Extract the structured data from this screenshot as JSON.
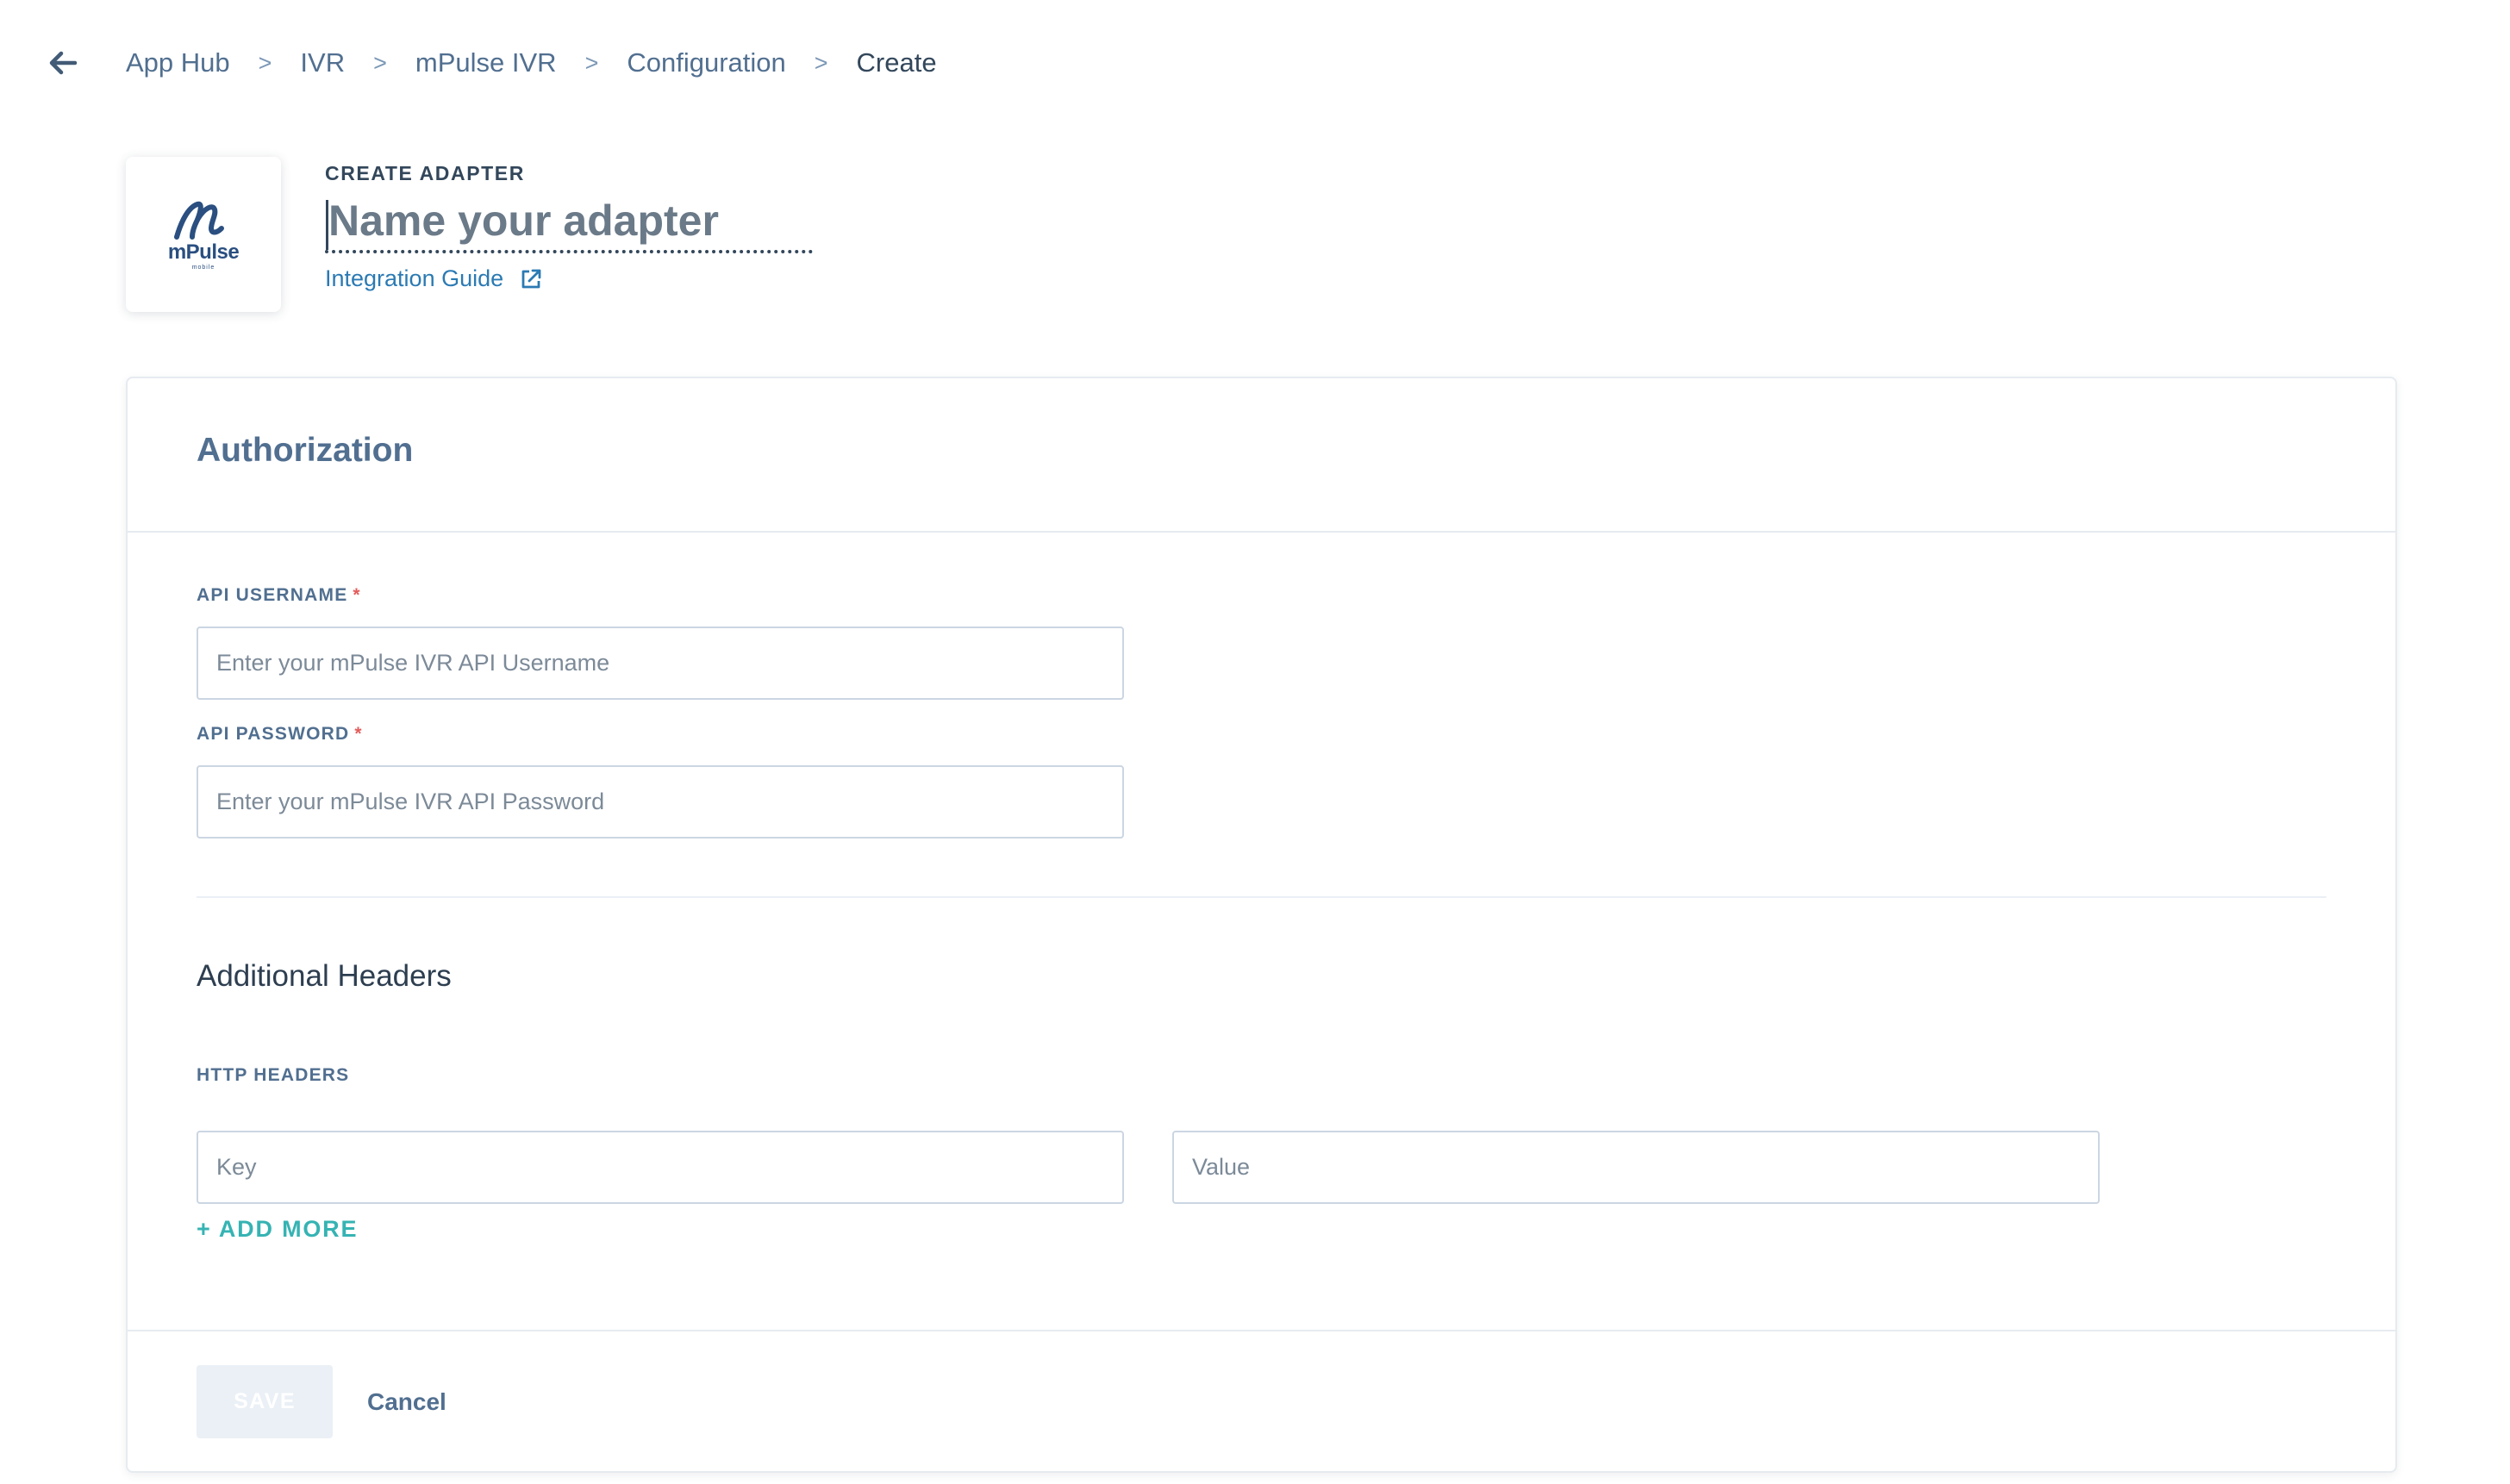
{
  "breadcrumb": {
    "items": [
      "App Hub",
      "IVR",
      "mPulse IVR",
      "Configuration",
      "Create"
    ],
    "separator": ">"
  },
  "header": {
    "logo": {
      "text": "mPulse",
      "sub": "mobile"
    },
    "label": "CREATE ADAPTER",
    "name_placeholder": "Name your adapter",
    "name_value": "",
    "guide_link": "Integration Guide"
  },
  "authorization": {
    "title": "Authorization",
    "username_label": "API USERNAME",
    "username_placeholder": "Enter your mPulse IVR API Username",
    "password_label": "API PASSWORD",
    "password_placeholder": "Enter your mPulse IVR API Password",
    "required_mark": "*"
  },
  "additional_headers": {
    "title": "Additional Headers",
    "http_label": "HTTP HEADERS",
    "key_placeholder": "Key",
    "value_placeholder": "Value",
    "add_more": "+ ADD MORE"
  },
  "footer": {
    "save_label": "SAVE",
    "cancel_label": "Cancel"
  },
  "colors": {
    "accent_teal": "#36b3b3",
    "link_blue": "#2b7ab3",
    "required_red": "#e35c5c",
    "brand_navy": "#2a4f80"
  },
  "icons": {
    "back": "arrow-left-icon",
    "external": "external-link-icon",
    "logo": "mpulse-logo"
  }
}
